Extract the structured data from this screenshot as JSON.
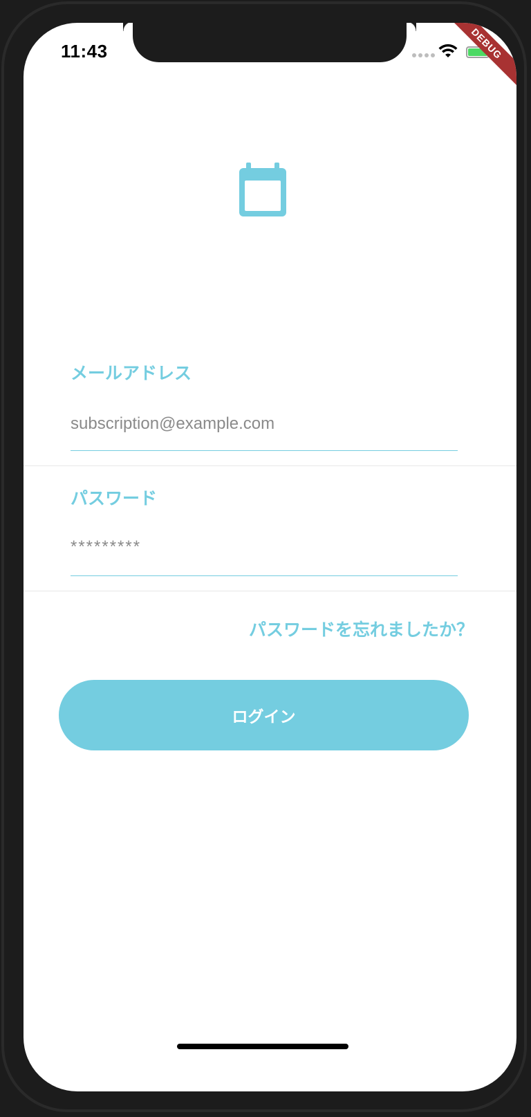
{
  "status_bar": {
    "time": "11:43",
    "debug_label": "DEBUG",
    "icons": [
      "signal-icon",
      "wifi-icon",
      "battery-charging-icon"
    ]
  },
  "app_icon": "calendar-icon",
  "email": {
    "label": "メールアドレス",
    "placeholder": "subscription@example.com"
  },
  "password": {
    "label": "パスワード",
    "placeholder": "*********"
  },
  "forgot_password_link": "パスワードを忘れましたか？",
  "login_button": "ログイン",
  "colors": {
    "accent": "#74cde0",
    "debug_ribbon": "#a83232",
    "placeholder_text": "#8a8a8a"
  }
}
